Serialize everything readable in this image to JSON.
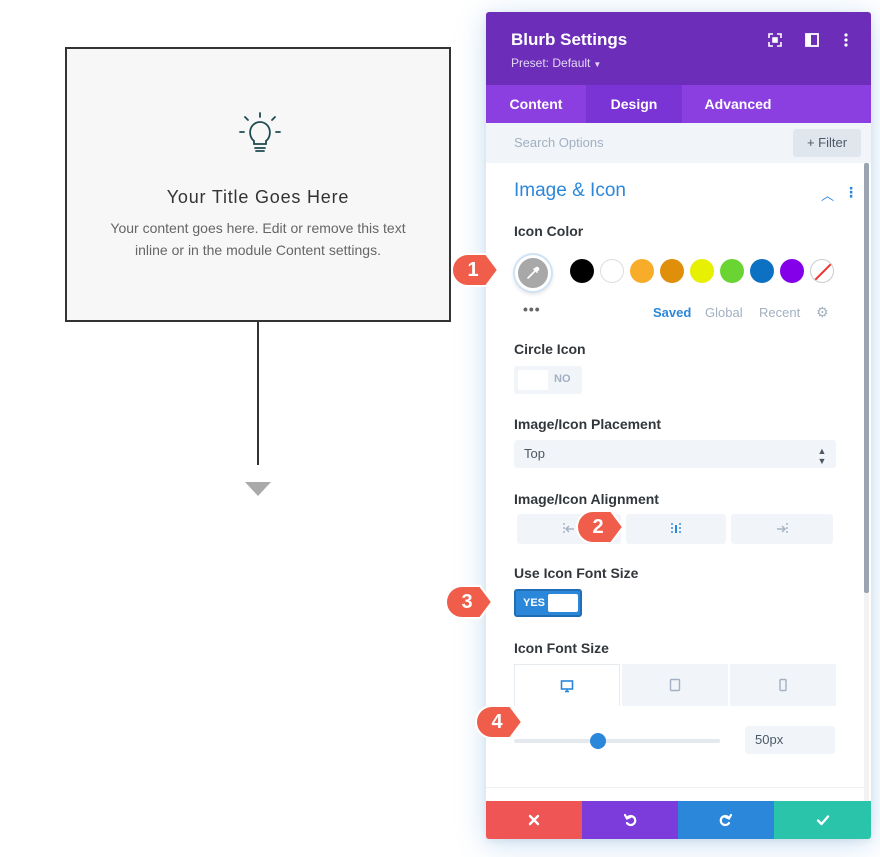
{
  "blurb": {
    "title": "Your Title Goes Here",
    "text": "Your content goes here. Edit or remove this text inline or in the module Content settings."
  },
  "panel": {
    "title": "Blurb Settings",
    "preset": "Preset: Default",
    "tabs": [
      "Content",
      "Design",
      "Advanced"
    ],
    "active_tab": "Design",
    "search_placeholder": "Search Options",
    "filter_label": "+ Filter",
    "section_title": "Image & Icon",
    "icon_color": {
      "label": "Icon Color",
      "swatches": [
        "#000000",
        "#ffffff",
        "#f7ad2a",
        "#e08f0a",
        "#e6f000",
        "#6ad432",
        "#0c71c3",
        "#8300e9",
        "none"
      ],
      "palette_tabs": [
        "Saved",
        "Global",
        "Recent"
      ],
      "active_palette": "Saved",
      "more_glyph": "•••"
    },
    "circle_icon": {
      "label": "Circle Icon",
      "value": "NO"
    },
    "placement": {
      "label": "Image/Icon Placement",
      "value": "Top",
      "arrow": "▲▼"
    },
    "alignment": {
      "label": "Image/Icon Alignment",
      "selected": "center"
    },
    "use_icon_font_size": {
      "label": "Use Icon Font Size",
      "value": "YES"
    },
    "icon_font_size": {
      "label": "Icon Font Size",
      "value": "50px",
      "slider_fraction": 0.41,
      "active_device": "desktop"
    }
  },
  "markers": [
    "1",
    "2",
    "3",
    "4"
  ],
  "colors": {
    "header": "#6c2eb9",
    "tabs": "#8c3fe0",
    "accent": "#2b87da",
    "cancel": "#ef5555",
    "undo": "#7c3bdb",
    "redo": "#2b87da",
    "save": "#29c4a9",
    "marker": "#f05d4a"
  }
}
